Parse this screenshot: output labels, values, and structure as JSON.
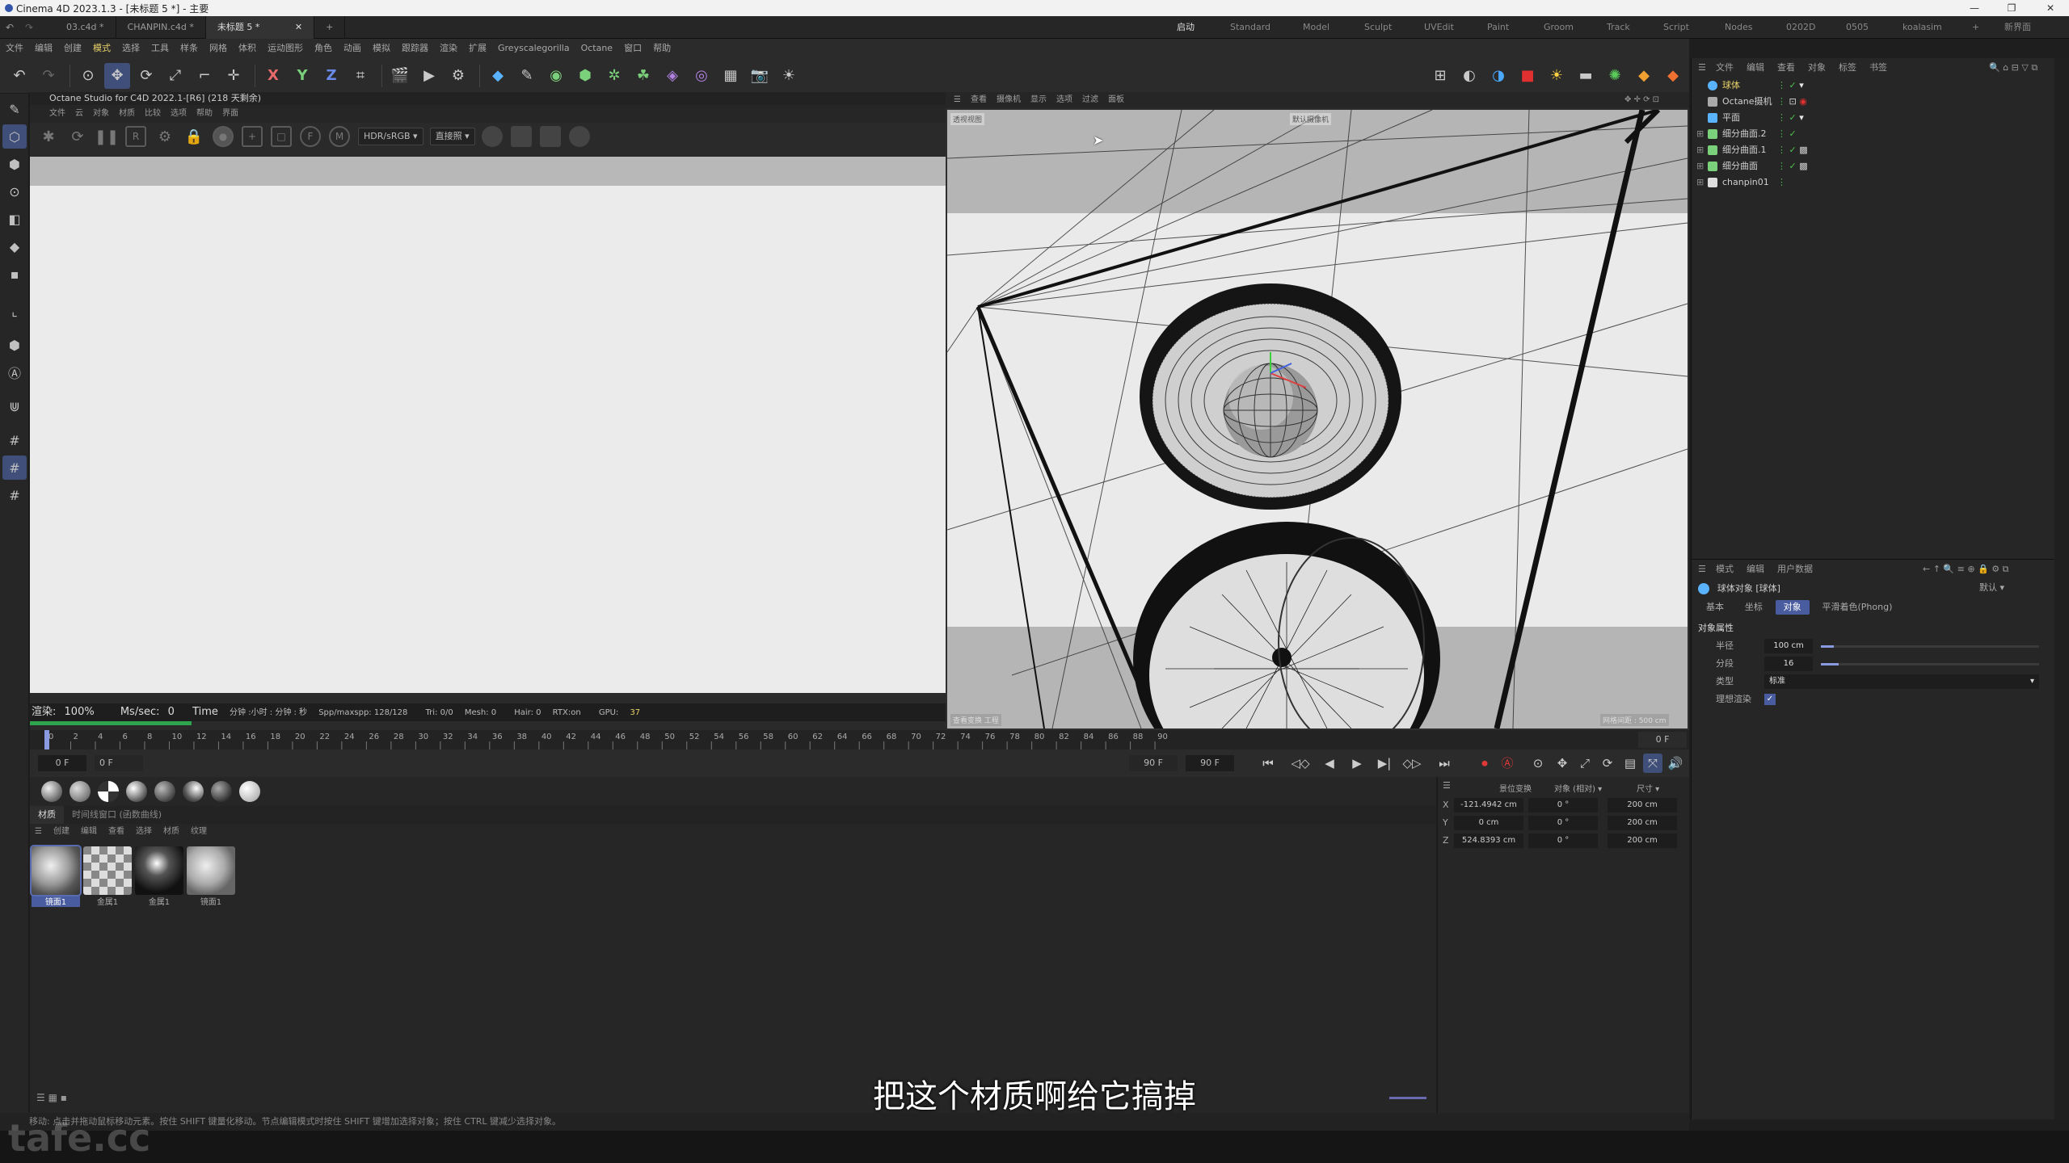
{
  "window": {
    "title": "Cinema 4D 2023.1.3 - [未标题 5 *] - 主要"
  },
  "tabs": [
    {
      "label": "03.c4d *"
    },
    {
      "label": "CHANPIN.c4d *"
    },
    {
      "label": "未标题 5 *"
    }
  ],
  "layouts": [
    "启动",
    "Standard",
    "Model",
    "Sculpt",
    "UVEdit",
    "Paint",
    "Groom",
    "Track",
    "Script",
    "Nodes",
    "0202D",
    "0505",
    "koalasim"
  ],
  "active_layout": "启动",
  "new_scene": "新界面",
  "menubar": [
    "文件",
    "编辑",
    "创建",
    "模式",
    "选择",
    "工具",
    "样条",
    "网格",
    "体积",
    "运动图形",
    "角色",
    "动画",
    "模拟",
    "跟踪器",
    "渲染",
    "扩展",
    "Greyscalegorilla",
    "Octane",
    "窗口",
    "帮助"
  ],
  "octane": {
    "title": "Octane Studio for C4D 2022.1-[R6] (218 天剩余)",
    "menu": [
      "文件",
      "云",
      "对象",
      "材质",
      "比较",
      "选项",
      "帮助",
      "界面"
    ],
    "color_mode": "HDR/sRGB",
    "kernel": "直接照",
    "status": {
      "render_label": "渲染:",
      "render_pct": "100%",
      "ms_label": "Ms/sec:",
      "ms_val": "0",
      "time_label": "Time",
      "time_val": "分钟 :小时 : 分钟 : 秒",
      "spp": "Spp/maxspp: 128/128",
      "tri": "Tri: 0/0",
      "mesh": "Mesh: 0",
      "hair": "Hair: 0",
      "rtx": "RTX:on",
      "gpu": "GPU:",
      "gpu_val": "37"
    },
    "progress": 1.0
  },
  "viewport": {
    "menu": [
      "查看",
      "摄像机",
      "显示",
      "选项",
      "过滤",
      "面板"
    ],
    "label_topleft": "透视视图",
    "label_camera": "默认摄像机",
    "label_bottomleft": "查看变换  工程",
    "label_grid": "网格间距 : 500 cm"
  },
  "timeline": {
    "ticks": [
      "0",
      "2",
      "4",
      "6",
      "8",
      "10",
      "12",
      "14",
      "16",
      "18",
      "20",
      "22",
      "24",
      "26",
      "28",
      "30",
      "32",
      "34",
      "36",
      "38",
      "40",
      "42",
      "44",
      "46",
      "48",
      "50",
      "52",
      "54",
      "56",
      "58",
      "60",
      "62",
      "64",
      "66",
      "68",
      "70",
      "72",
      "74",
      "76",
      "78",
      "80",
      "82",
      "84",
      "86",
      "88",
      "90"
    ],
    "current_frame": "0 F",
    "start": "0 F",
    "start2": "0 F",
    "end": "90 F",
    "end2": "90 F"
  },
  "materials": {
    "tabs": [
      "材质",
      "时间线窗口 (函数曲线)"
    ],
    "menu": [
      "创建",
      "编辑",
      "查看",
      "选择",
      "材质",
      "纹理"
    ],
    "items": [
      {
        "name": "镜面1"
      },
      {
        "name": "金属1"
      },
      {
        "name": "金属1"
      },
      {
        "name": "镜面1"
      }
    ]
  },
  "coords": {
    "header": [
      "景位变换",
      "对象 (相对)",
      "尺寸"
    ],
    "rows": [
      {
        "axis": "X",
        "pos": "-121.4942 cm",
        "rot": "0 °",
        "size": "200 cm"
      },
      {
        "axis": "Y",
        "pos": "0 cm",
        "rot": "0 °",
        "size": "200 cm"
      },
      {
        "axis": "Z",
        "pos": "524.8393 cm",
        "rot": "0 °",
        "size": "200 cm"
      }
    ]
  },
  "objects": {
    "menu": [
      "文件",
      "编辑",
      "查看",
      "对象",
      "标签",
      "书签"
    ],
    "items": [
      {
        "name": "球体",
        "color": "#5ab3ff"
      },
      {
        "name": "Octane摄机",
        "color": "#aaaaaa"
      },
      {
        "name": "平面",
        "color": "#5ab3ff"
      },
      {
        "name": "细分曲面.2",
        "color": "#7bd07b"
      },
      {
        "name": "细分曲面.1",
        "color": "#7bd07b"
      },
      {
        "name": "细分曲面",
        "color": "#7bd07b"
      },
      {
        "name": "chanpin01",
        "color": "#dddddd"
      }
    ]
  },
  "attributes": {
    "menu": [
      "模式",
      "编辑",
      "用户数据"
    ],
    "object": "球体对象 [球体]",
    "preset": "默认",
    "tabs": [
      "基本",
      "坐标",
      "对象",
      "平滑着色(Phong)"
    ],
    "section": "对象属性",
    "rows": [
      {
        "label": "半径",
        "value": "100 cm"
      },
      {
        "label": "分段",
        "value": "16"
      },
      {
        "label": "类型",
        "value": "标准"
      },
      {
        "label": "理想渲染",
        "value": ""
      }
    ]
  },
  "statusbar": "移动: 点击并拖动鼠标移动元素。按住 SHIFT 键量化移动。节点编辑模式时按住 SHIFT 键增加选择对象；按住 CTRL 键减少选择对象。",
  "subtitle": "把这个材质啊给它搞掉",
  "watermark": "tafe.cc"
}
